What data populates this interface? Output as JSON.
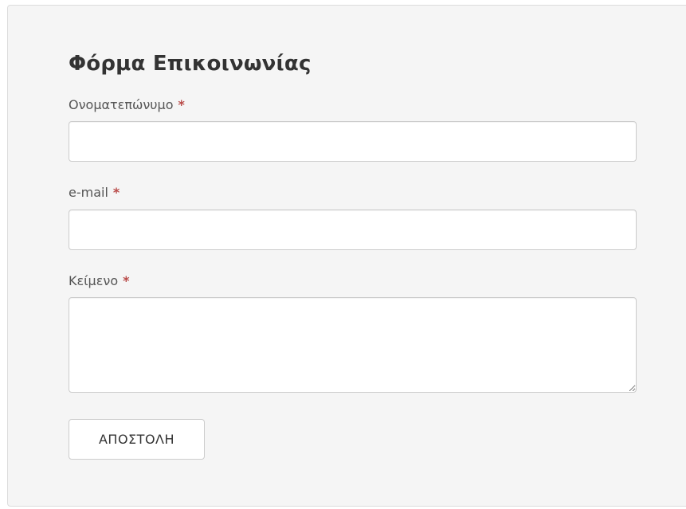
{
  "form": {
    "title": "Φόρμα Επικοινωνίας",
    "required_marker": "*",
    "fields": [
      {
        "label": "Ονοματεπώνυμο",
        "value": "",
        "placeholder": ""
      },
      {
        "label": "e-mail",
        "value": "",
        "placeholder": ""
      },
      {
        "label": "Κείμενο",
        "value": "",
        "placeholder": ""
      }
    ],
    "submit_label": "ΑΠΟΣΤΟΛΗ"
  },
  "colors": {
    "panel_background": "#f5f5f5",
    "panel_border": "#dcdcdc",
    "required_marker": "#b94a48",
    "title_text": "#333333",
    "label_text": "#555555"
  }
}
